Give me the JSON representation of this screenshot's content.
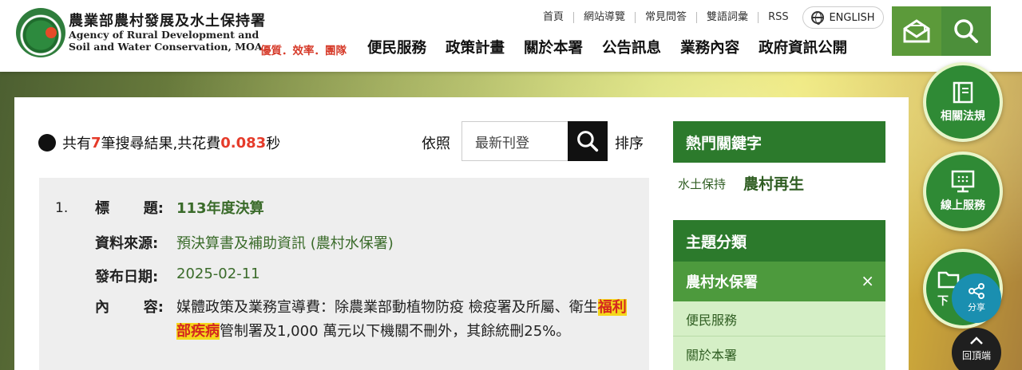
{
  "header": {
    "org_name_zh": "農業部農村發展及水土保持署",
    "org_name_en_line1": "Agency of Rural Development and",
    "org_name_en_line2": "Soil and Water Conservation, MOA",
    "slogan": "優質．效率．團隊",
    "top_links": [
      "首頁",
      "網站導覽",
      "常見問答",
      "雙語詞彙",
      "RSS"
    ],
    "english_label": "ENGLISH",
    "nav": [
      "便民服務",
      "政策計畫",
      "關於本署",
      "公告訊息",
      "業務內容",
      "政府資訊公開"
    ]
  },
  "results": {
    "summary_prefix": "共有",
    "count": "7",
    "summary_mid": "筆搜尋結果,共花費",
    "time": "0.083",
    "summary_suffix": "秒",
    "sort_prefix": "依照",
    "sort_value": "最新刊登",
    "sort_suffix": "排序",
    "items": [
      {
        "number": "1.",
        "title_label": [
          "標",
          "題:"
        ],
        "title": "113年度決算",
        "source_label": "資料來源:",
        "source": "預決算書及補助資訊 (農村水保署)",
        "date_label": "發布日期:",
        "date": "2025-02-11",
        "content_label": [
          "內",
          "容:"
        ],
        "content_before": "媒體政策及業務宣導費：除農業部動植物防疫 檢疫署及所屬、衛生",
        "content_highlight": "福利部疾病",
        "content_after": "管制署及1,000 萬元以下機關不刪外，其餘統刪25%。"
      }
    ]
  },
  "sidebar": {
    "hot_keywords_title": "熱門關鍵字",
    "keywords": [
      "水土保持",
      "農村再生"
    ],
    "topics_title": "主題分類",
    "active_topic": "農村水保署",
    "close_symbol": "×",
    "topics": [
      "便民服務",
      "關於本署"
    ]
  },
  "floating": {
    "regulations": "相關法規",
    "online_services": "線上服務",
    "download_partial": "下",
    "share": "分享",
    "back_to_top": "回頂端"
  },
  "colors": {
    "primary_green": "#2c7a2c",
    "accent_red": "#e53b2a",
    "highlight": "#f5d71c",
    "share_blue": "#1a8fb0"
  },
  "icons": [
    "mail-icon",
    "search-icon",
    "globe-icon",
    "law-book-icon",
    "online-service-icon",
    "share-icon",
    "arrow-up-icon",
    "close-icon"
  ]
}
